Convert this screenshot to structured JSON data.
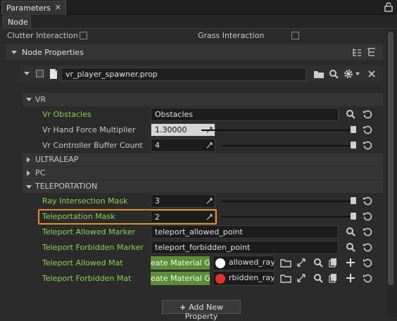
{
  "window": {
    "tab_title": "Parameters",
    "close_glyph": "✕"
  },
  "subtabs": [
    "Node"
  ],
  "top": {
    "clutter_label": "Clutter Interaction",
    "grass_label": "Grass Interaction"
  },
  "node_properties": {
    "label": "Node Properties"
  },
  "property_file": {
    "value": "vr_player_spawner.prop"
  },
  "sections": {
    "vr": "VR",
    "ultraleap": "ULTRALEAP",
    "pc": "PC",
    "teleportation": "TELEPORTATION"
  },
  "vr_fields": {
    "obstacles_label": "Vr Obstacles",
    "obstacles_value": "Obstacles",
    "hand_force_label": "Vr Hand Force Multiplier",
    "hand_force_value": "1.30000",
    "hand_force_level": 1.0,
    "buffer_label": "Vr Controller Buffer Count",
    "buffer_value": "4",
    "buffer_level": 1.0
  },
  "teleport_fields": {
    "ray_mask_label": "Ray Intersection Mask",
    "ray_mask_value": "3",
    "ray_mask_level": 1.0,
    "tp_mask_label": "Teleportation Mask",
    "tp_mask_value": "2",
    "tp_mask_level": 1.0,
    "allowed_marker_label": "Teleport Allowed Marker",
    "allowed_marker_value": "teleport_allowed_point",
    "forbidden_marker_label": "Teleport Forbidden Marker",
    "forbidden_marker_value": "teleport_forbidden_point",
    "allowed_mat_label": "Teleport Allowed Mat",
    "allowed_mat_button": "eate Material Gra",
    "allowed_mat_value": "allowed_ray",
    "allowed_mat_color": "#ffffff",
    "forbidden_mat_label": "Teleport Forbidden Mat",
    "forbidden_mat_button": "eate Material Gra",
    "forbidden_mat_value": "rbidden_ray",
    "forbidden_mat_color": "#e53030"
  },
  "add_property": {
    "label": "Add New Property",
    "plus": "+"
  },
  "colors": {
    "accent_green": "#8fd14f",
    "highlight": "#e0902a",
    "material_button": "#5e8c3a"
  }
}
